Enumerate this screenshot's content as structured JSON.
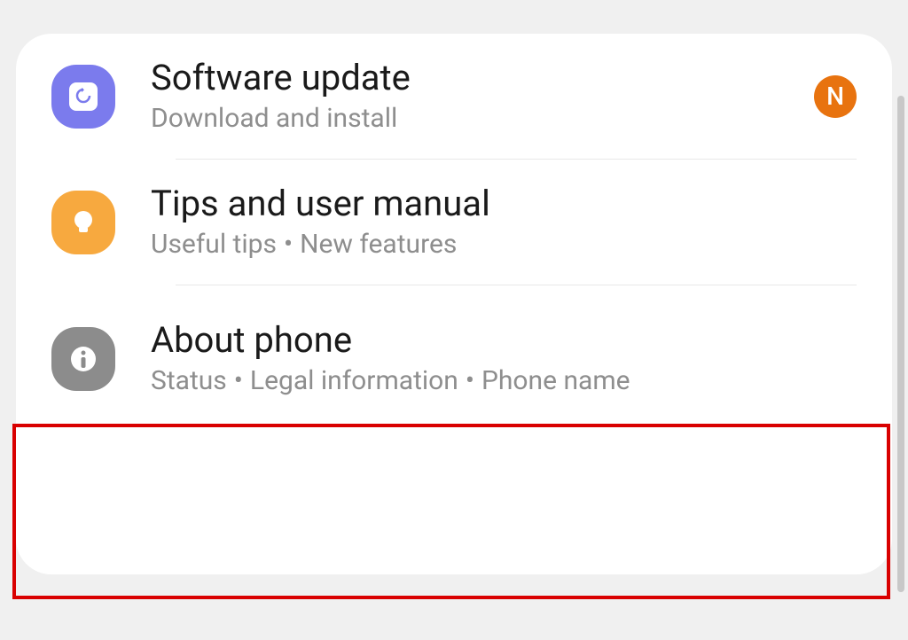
{
  "settings": [
    {
      "title": "Software update",
      "subtitle": "Download and install",
      "icon": "update",
      "iconColor": "purple",
      "badge": "N"
    },
    {
      "title": "Tips and user manual",
      "subtitleParts": [
        "Useful tips",
        "New features"
      ],
      "icon": "bulb",
      "iconColor": "orange"
    },
    {
      "title": "About phone",
      "subtitleParts": [
        "Status",
        "Legal information",
        "Phone name"
      ],
      "icon": "info",
      "iconColor": "gray",
      "highlighted": true
    }
  ]
}
